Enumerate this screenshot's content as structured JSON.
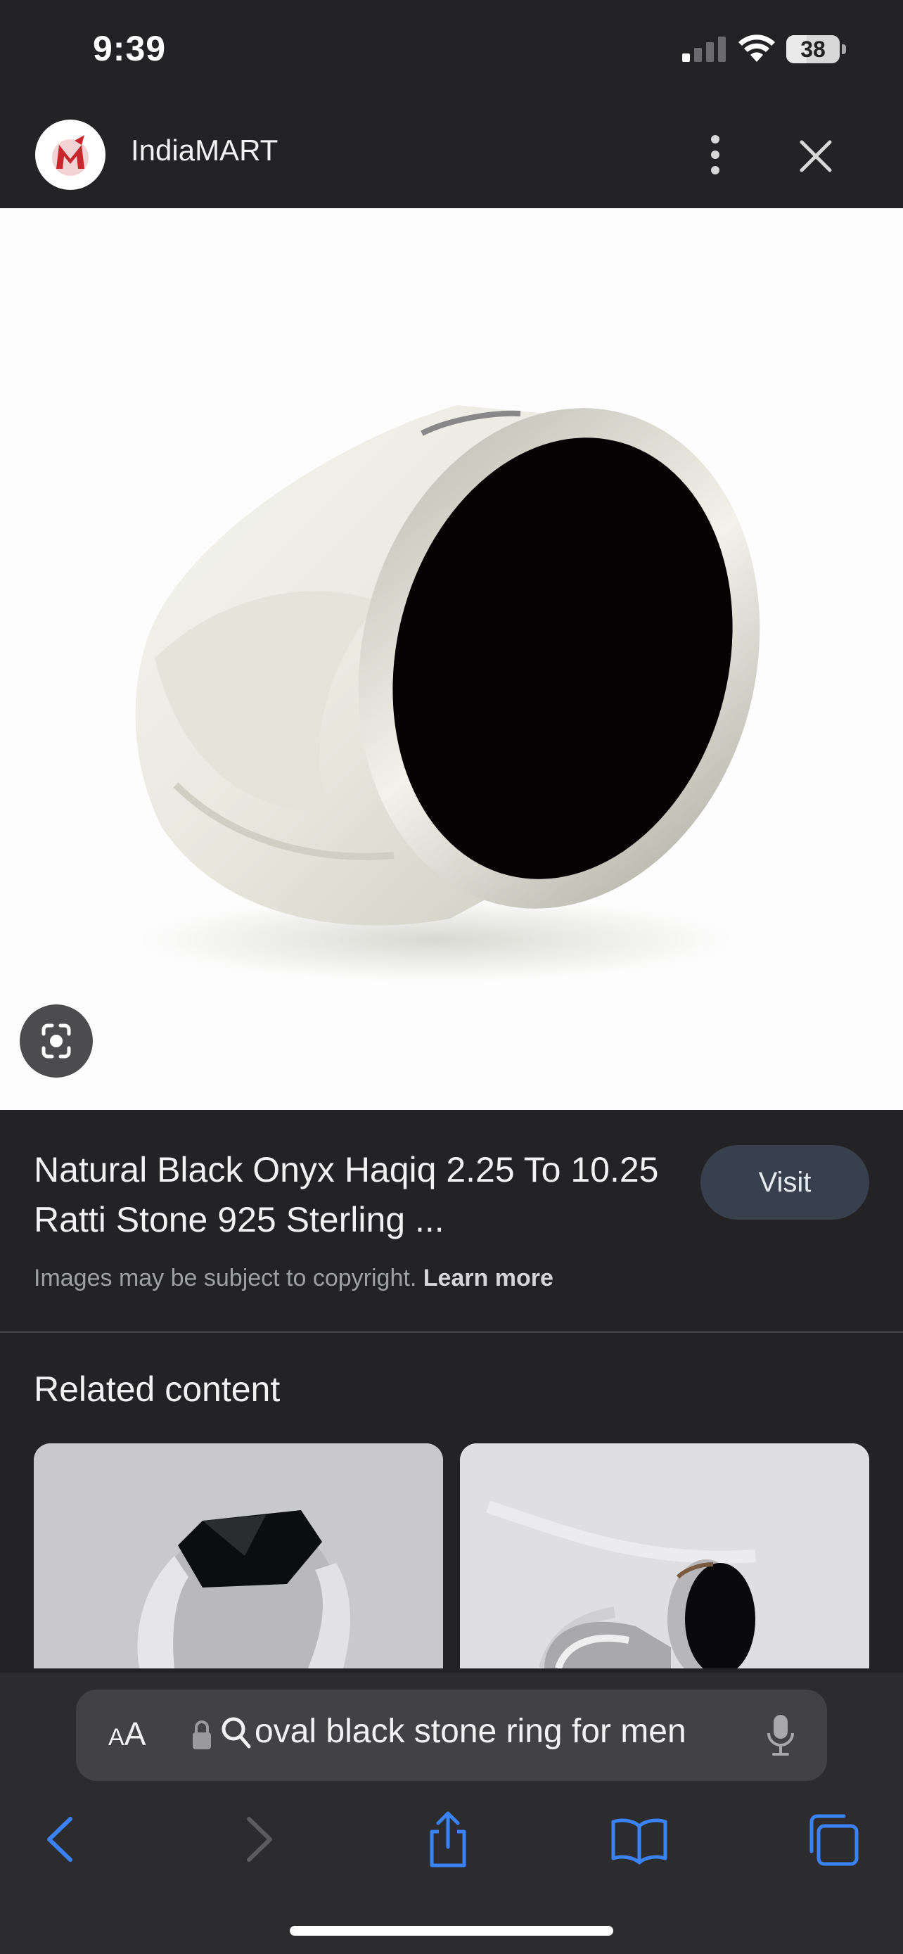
{
  "status_bar": {
    "time": "9:39",
    "battery_level": "38",
    "battery_fraction": 0.38,
    "signal_bars_active": 1,
    "signal_bars_total": 4
  },
  "header": {
    "site_name": "IndiaMART",
    "icons": {
      "logo": "indiamart-logo",
      "more": "more-vertical-icon",
      "close": "close-icon"
    }
  },
  "image": {
    "icons": {
      "lens": "google-lens-icon"
    }
  },
  "result": {
    "title": "Natural Black Onyx Haqiq 2.25 To 10.25 Ratti Stone 925 Sterling ...",
    "visit_label": "Visit",
    "copyright_text": "Images may be subject to copyright.",
    "learn_more_label": "Learn more"
  },
  "related": {
    "heading": "Related content"
  },
  "browser": {
    "aa_small": "A",
    "aa_large": "A",
    "url_text": "oval black stone ring for men",
    "icons": {
      "lock": "lock-icon",
      "search": "search-icon",
      "mic": "microphone-icon",
      "back": "chevron-left-icon",
      "forward": "chevron-right-icon",
      "share": "share-icon",
      "bookmarks": "book-icon",
      "tabs": "tabs-icon"
    }
  },
  "colors": {
    "background": "#232325",
    "accent_blue": "#3b82f6",
    "visit_button": "#38404d",
    "logo_red": "#c8262d"
  }
}
